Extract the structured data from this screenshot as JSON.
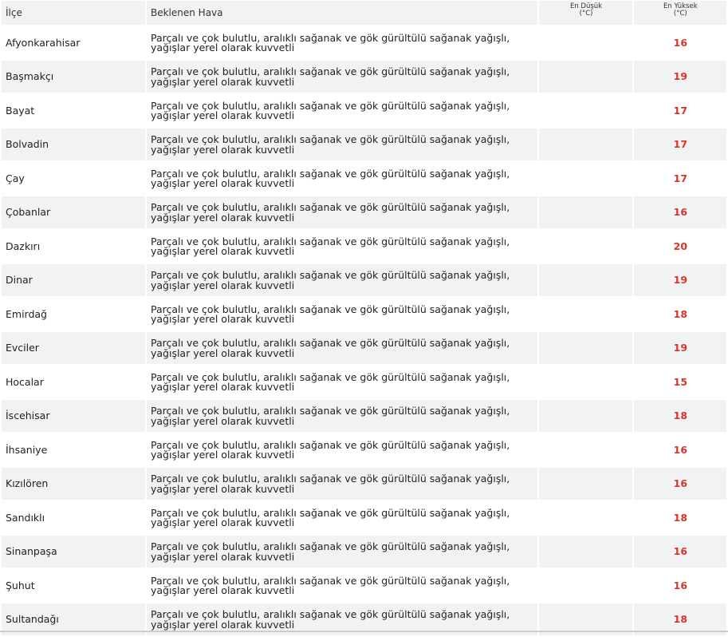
{
  "table": {
    "headers": {
      "district": "İlçe",
      "weather": "Beklenen Hava",
      "min": "En Düşük\n(°C)",
      "max": "En Yüksek\n(°C)"
    },
    "rows": [
      {
        "district": "Afyonkarahisar",
        "weather": "Parçalı ve çok bulutlu, aralıklı sağanak ve gök gürültülü sağanak yağışlı, yağışlar yerel olarak kuvvetli",
        "min": "",
        "max": "16"
      },
      {
        "district": "Başmakçı",
        "weather": "Parçalı ve çok bulutlu, aralıklı sağanak ve gök gürültülü sağanak yağışlı, yağışlar yerel olarak kuvvetli",
        "min": "",
        "max": "19"
      },
      {
        "district": "Bayat",
        "weather": "Parçalı ve çok bulutlu, aralıklı sağanak ve gök gürültülü sağanak yağışlı, yağışlar yerel olarak kuvvetli",
        "min": "",
        "max": "17"
      },
      {
        "district": "Bolvadin",
        "weather": "Parçalı ve çok bulutlu, aralıklı sağanak ve gök gürültülü sağanak yağışlı, yağışlar yerel olarak kuvvetli",
        "min": "",
        "max": "17"
      },
      {
        "district": "Çay",
        "weather": "Parçalı ve çok bulutlu, aralıklı sağanak ve gök gürültülü sağanak yağışlı, yağışlar yerel olarak kuvvetli",
        "min": "",
        "max": "17"
      },
      {
        "district": "Çobanlar",
        "weather": "Parçalı ve çok bulutlu, aralıklı sağanak ve gök gürültülü sağanak yağışlı, yağışlar yerel olarak kuvvetli",
        "min": "",
        "max": "16"
      },
      {
        "district": "Dazkırı",
        "weather": "Parçalı ve çok bulutlu, aralıklı sağanak ve gök gürültülü sağanak yağışlı, yağışlar yerel olarak kuvvetli",
        "min": "",
        "max": "20"
      },
      {
        "district": "Dinar",
        "weather": "Parçalı ve çok bulutlu, aralıklı sağanak ve gök gürültülü sağanak yağışlı, yağışlar yerel olarak kuvvetli",
        "min": "",
        "max": "19"
      },
      {
        "district": "Emirdağ",
        "weather": "Parçalı ve çok bulutlu, aralıklı sağanak ve gök gürültülü sağanak yağışlı, yağışlar yerel olarak kuvvetli",
        "min": "",
        "max": "18"
      },
      {
        "district": "Evciler",
        "weather": "Parçalı ve çok bulutlu, aralıklı sağanak ve gök gürültülü sağanak yağışlı, yağışlar yerel olarak kuvvetli",
        "min": "",
        "max": "19"
      },
      {
        "district": "Hocalar",
        "weather": "Parçalı ve çok bulutlu, aralıklı sağanak ve gök gürültülü sağanak yağışlı, yağışlar yerel olarak kuvvetli",
        "min": "",
        "max": "15"
      },
      {
        "district": "İscehisar",
        "weather": "Parçalı ve çok bulutlu, aralıklı sağanak ve gök gürültülü sağanak yağışlı, yağışlar yerel olarak kuvvetli",
        "min": "",
        "max": "18"
      },
      {
        "district": "İhsaniye",
        "weather": "Parçalı ve çok bulutlu, aralıklı sağanak ve gök gürültülü sağanak yağışlı, yağışlar yerel olarak kuvvetli",
        "min": "",
        "max": "16"
      },
      {
        "district": "Kızılören",
        "weather": "Parçalı ve çok bulutlu, aralıklı sağanak ve gök gürültülü sağanak yağışlı, yağışlar yerel olarak kuvvetli",
        "min": "",
        "max": "16"
      },
      {
        "district": "Sandıklı",
        "weather": "Parçalı ve çok bulutlu, aralıklı sağanak ve gök gürültülü sağanak yağışlı, yağışlar yerel olarak kuvvetli",
        "min": "",
        "max": "18"
      },
      {
        "district": "Sinanpaşa",
        "weather": "Parçalı ve çok bulutlu, aralıklı sağanak ve gök gürültülü sağanak yağışlı, yağışlar yerel olarak kuvvetli",
        "min": "",
        "max": "16"
      },
      {
        "district": "Şuhut",
        "weather": "Parçalı ve çok bulutlu, aralıklı sağanak ve gök gürültülü sağanak yağışlı, yağışlar yerel olarak kuvvetli",
        "min": "",
        "max": "16"
      },
      {
        "district": "Sultandağı",
        "weather": "Parçalı ve çok bulutlu, aralıklı sağanak ve gök gürültülü sağanak yağışlı, yağışlar yerel olarak kuvvetli",
        "min": "",
        "max": "18"
      }
    ]
  },
  "colors": {
    "header_bg": "#f1f2f4",
    "stripe_bg": "#f1f2f4",
    "max_temp": "#d9362b"
  }
}
